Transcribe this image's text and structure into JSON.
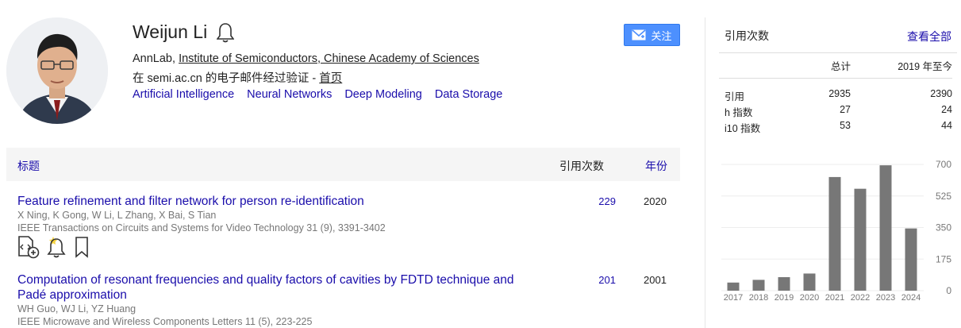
{
  "profile": {
    "name": "Weijun Li",
    "affiliation_prefix": "AnnLab, ",
    "affiliation_link": "Institute of Semiconductors, Chinese Academy of Sciences",
    "verified_text": "在 semi.ac.cn 的电子邮件经过验证 - ",
    "homepage_link": "首页",
    "interests": [
      "Artificial Intelligence",
      "Neural Networks",
      "Deep Modeling",
      "Data Storage"
    ],
    "follow_label": "关注"
  },
  "table": {
    "col_title": "标题",
    "col_cited": "引用次数",
    "col_year": "年份"
  },
  "articles": [
    {
      "title": "Feature refinement and filter network for person re-identification",
      "authors": "X Ning, K Gong, W Li, L Zhang, X Bai, S Tian",
      "venue": "IEEE Transactions on Circuits and Systems for Video Technology 31 (9), 3391-3402",
      "cited": "229",
      "year": "2020"
    },
    {
      "title": "Computation of resonant frequencies and quality factors of cavities by FDTD technique and Padé approximation",
      "authors": "WH Guo, WJ Li, YZ Huang",
      "venue": "IEEE Microwave and Wireless Components Letters 11 (5), 223-225",
      "cited": "201",
      "year": "2001"
    }
  ],
  "citations": {
    "title": "引用次数",
    "view_all": "查看全部",
    "headers": [
      "",
      "总计",
      "2019 年至今"
    ],
    "rows": [
      [
        "引用",
        "2935",
        "2390"
      ],
      [
        "h 指数",
        "27",
        "24"
      ],
      [
        "i10 指数",
        "53",
        "44"
      ]
    ]
  },
  "chart_data": {
    "type": "bar",
    "categories": [
      "2017",
      "2018",
      "2019",
      "2020",
      "2021",
      "2022",
      "2023",
      "2024"
    ],
    "values": [
      45,
      60,
      75,
      95,
      630,
      565,
      695,
      345
    ],
    "yticks": [
      0,
      175,
      350,
      525,
      700
    ],
    "ylim": [
      0,
      700
    ],
    "bar_color": "#777777"
  },
  "colors": {
    "link": "#1a0dab",
    "button": "#4d90fe"
  }
}
